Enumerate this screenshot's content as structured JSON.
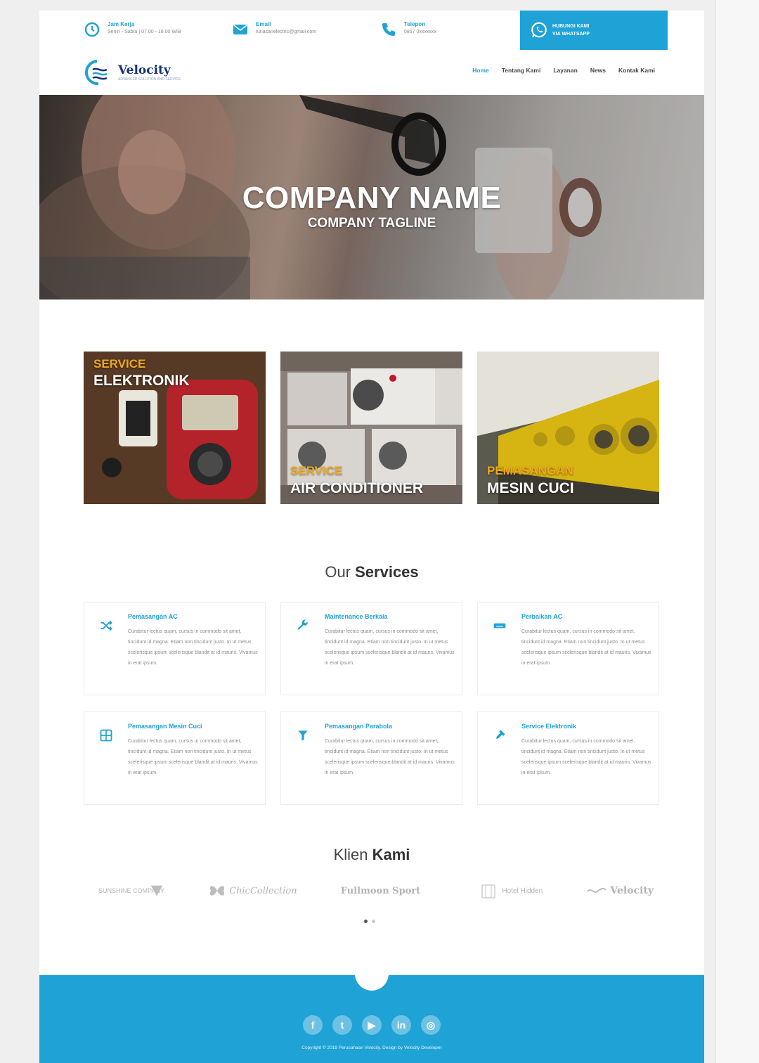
{
  "topbar": {
    "hours": {
      "label": "Jam Kerja",
      "value": "Senin - Sabtu | 07.00 - 16.00 WIB",
      "icon": "clock-icon"
    },
    "email": {
      "label": "Email",
      "value": "tunasanelectric@gmail.com",
      "icon": "envelope-icon"
    },
    "phone": {
      "label": "Telepon",
      "value": "0857 0xxxxxxx",
      "icon": "phone-icon"
    },
    "whatsapp": {
      "line1": "HUBUNGI KAMI",
      "line2": "VIA WHATSAPP",
      "icon": "whatsapp-icon"
    }
  },
  "logo": {
    "name": "Velocity",
    "tagline": "ADVANCED SOLUTION AND SERVICE"
  },
  "menu": [
    {
      "label": "Home",
      "active": true
    },
    {
      "label": "Tentang Kami",
      "active": false
    },
    {
      "label": "Layanan",
      "active": false
    },
    {
      "label": "News",
      "active": false
    },
    {
      "label": "Kontak Kami",
      "active": false
    }
  ],
  "hero": {
    "title": "COMPANY NAME",
    "tagline": "COMPANY TAGLINE"
  },
  "tiles": [
    {
      "line1": "SERVICE",
      "line2": "ELEKTRONIK"
    },
    {
      "line1": "SERVICE",
      "line2": "AIR CONDITIONER"
    },
    {
      "line1": "PEMASANGAN",
      "line2": "MESIN CUCI"
    }
  ],
  "services": {
    "title_light": "Our ",
    "title_bold": "Services",
    "items": [
      {
        "title": "Pemasangan AC",
        "icon": "shuffle-icon",
        "desc": "Curabitur lectus quam, cursus in commodo sit amet, tincidunt id magna. Etiam non tincidunt justo. In ut metus scelerisque ipsum scelerisque blandit at id mauris. Vivamus in erat ipsum."
      },
      {
        "title": "Maintenance Berkala",
        "icon": "wrench-icon",
        "desc": "Curabitur lectus quam, cursus in commodo sit amet, tincidunt id magna. Etiam non tincidunt justo. In ut metus scelerisque ipsum scelerisque blandit at id mauris. Vivamus in erat ipsum."
      },
      {
        "title": "Perbaikan AC",
        "icon": "air-conditioner-icon",
        "desc": "Curabitur lectus quam, cursus in commodo sit amet, tincidunt id magna. Etiam non tincidunt justo. In ut metus scelerisque ipsum scelerisque blandit at id mauris. Vivamus in erat ipsum."
      },
      {
        "title": "Pemasangan Mesin Cuci",
        "icon": "grid-icon",
        "desc": "Curabitur lectus quam, cursus in commodo sit amet, tincidunt id magna. Etiam non tincidunt justo. In ut metus scelerisque ipsum scelerisque blandit at id mauris. Vivamus in erat ipsum."
      },
      {
        "title": "Pemasangan Parabola",
        "icon": "antenna-icon",
        "desc": "Curabitur lectus quam, cursus in commodo sit amet, tincidunt id magna. Etiam non tincidunt justo. In ut metus scelerisque ipsum scelerisque blandit at id mauris. Vivamus in erat ipsum."
      },
      {
        "title": "Service Elektronik",
        "icon": "plug-icon",
        "desc": "Curabitur lectus quam, cursus in commodo sit amet, tincidunt id magna. Etiam non tincidunt justo. In ut metus scelerisque ipsum scelerisque blandit at id mauris. Vivamus in erat ipsum."
      }
    ]
  },
  "clients": {
    "title_light": "Klien ",
    "title_bold": "Kami",
    "logos": [
      "SUNSHINE COMPANY",
      "ChicCollection",
      "Fullmoon Sport",
      "Hotel Hidden",
      "Velocity"
    ]
  },
  "footer": {
    "socials": [
      {
        "name": "facebook-icon",
        "glyph": "f"
      },
      {
        "name": "twitter-icon",
        "glyph": "t"
      },
      {
        "name": "youtube-icon",
        "glyph": "▶"
      },
      {
        "name": "linkedin-icon",
        "glyph": "in"
      },
      {
        "name": "instagram-icon",
        "glyph": "◎"
      }
    ],
    "copyright": "Copyright © 2019 Perusahaan Velocity. Design by Velocity Developer"
  },
  "colors": {
    "accent": "#1fa2d6",
    "tile_label": "#f0a81c",
    "heading": "#333333"
  }
}
